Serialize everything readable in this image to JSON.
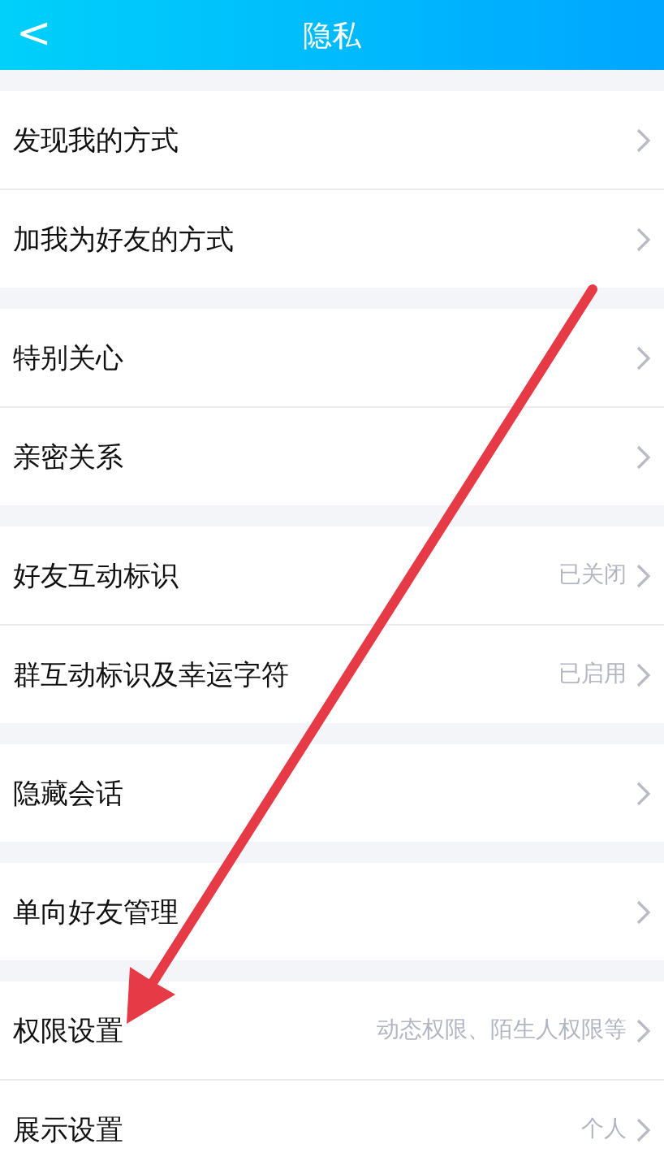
{
  "header": {
    "back": "<",
    "title": "隐私"
  },
  "groups": [
    {
      "items": [
        {
          "label": "发现我的方式"
        },
        {
          "label": "加我为好友的方式"
        }
      ]
    },
    {
      "items": [
        {
          "label": "特别关心"
        },
        {
          "label": "亲密关系"
        }
      ]
    },
    {
      "items": [
        {
          "label": "好友互动标识",
          "value": "已关闭"
        },
        {
          "label": "群互动标识及幸运字符",
          "value": "已启用"
        }
      ]
    },
    {
      "items": [
        {
          "label": "隐藏会话"
        }
      ]
    },
    {
      "items": [
        {
          "label": "单向好友管理"
        }
      ]
    },
    {
      "items": [
        {
          "label": "权限设置",
          "value": "动态权限、陌生人权限等"
        },
        {
          "label": "展示设置",
          "value": "个人"
        }
      ]
    }
  ]
}
